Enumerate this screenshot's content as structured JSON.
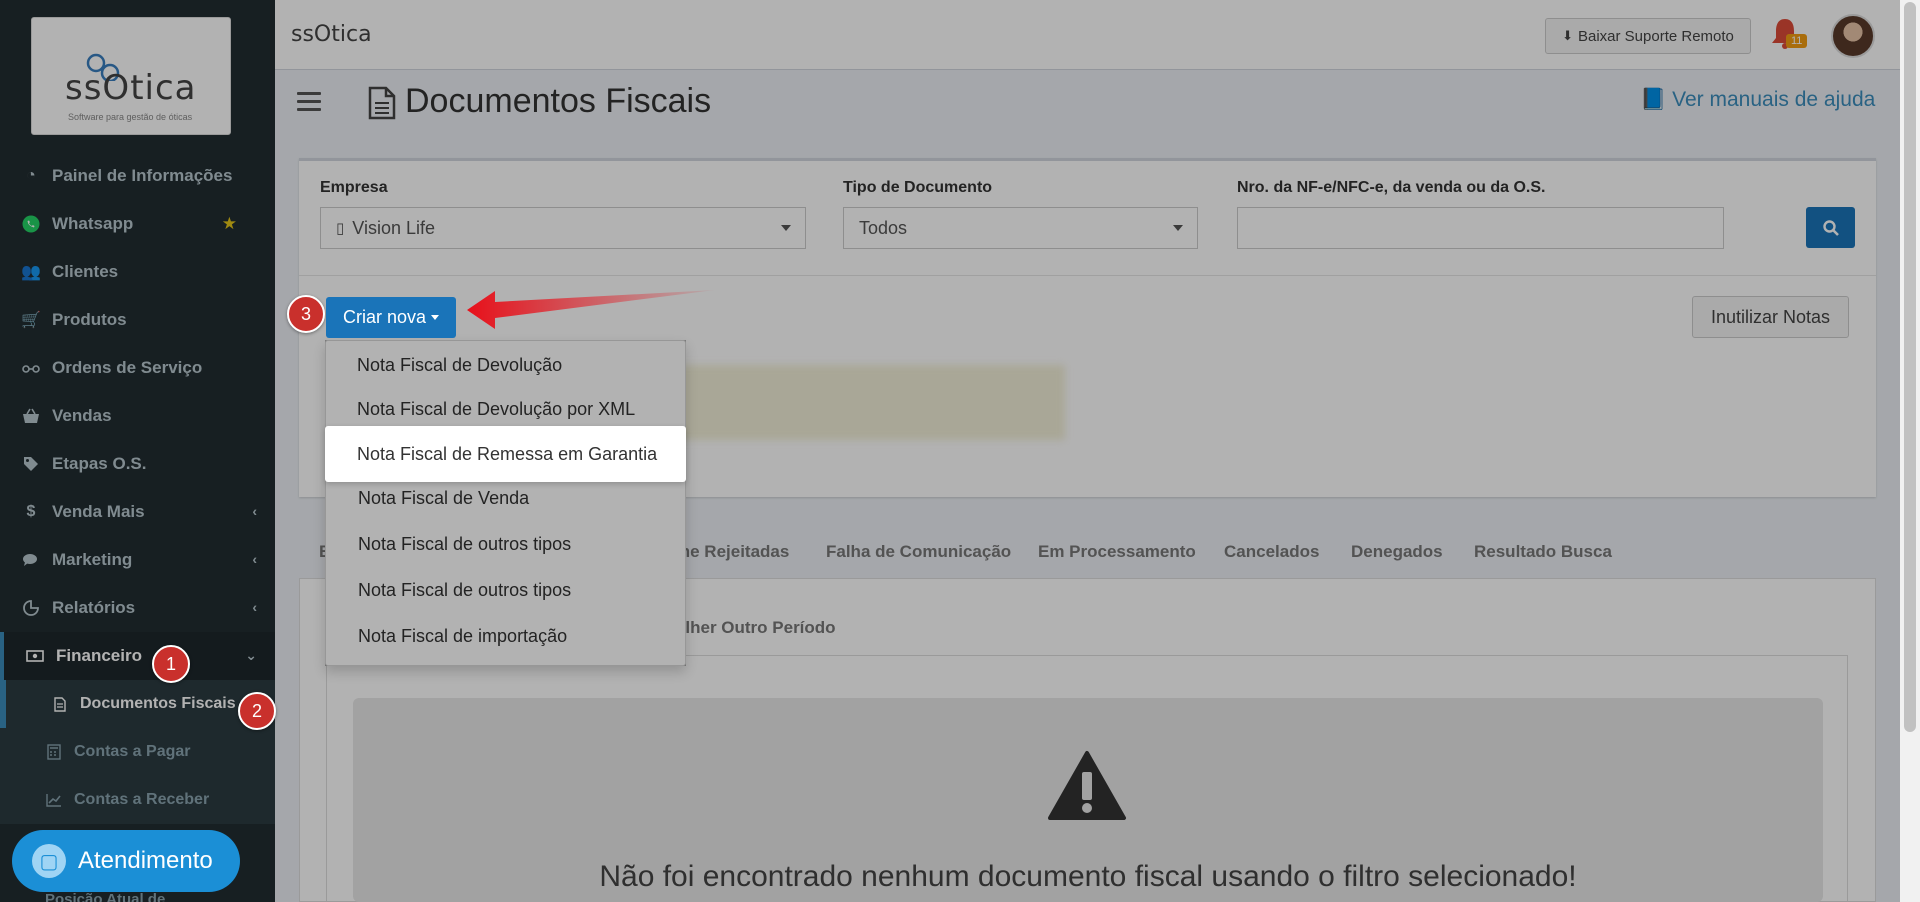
{
  "sidebar": {
    "logo": {
      "brand": "ssOtica",
      "tagline": "Software para gestão de óticas"
    },
    "items": [
      {
        "label": "Painel de Informações",
        "icon": "dashboard-icon"
      },
      {
        "label": "Whatsapp",
        "icon": "whatsapp-icon"
      },
      {
        "label": "Clientes",
        "icon": "users-icon"
      },
      {
        "label": "Produtos",
        "icon": "cart-icon"
      },
      {
        "label": "Ordens de Serviço",
        "icon": "glasses-icon"
      },
      {
        "label": "Vendas",
        "icon": "basket-icon"
      },
      {
        "label": "Etapas O.S.",
        "icon": "tag-icon"
      },
      {
        "label": "Venda Mais",
        "icon": "dollar-icon"
      },
      {
        "label": "Marketing",
        "icon": "comments-icon"
      },
      {
        "label": "Relatórios",
        "icon": "pie-chart-icon"
      },
      {
        "label": "Financeiro",
        "icon": "money-icon"
      }
    ],
    "subitems": [
      {
        "label": "Documentos Fiscais",
        "icon": "file-icon"
      },
      {
        "label": "Contas a Pagar",
        "icon": "calculator-icon"
      },
      {
        "label": "Contas a Receber",
        "icon": "line-chart-icon"
      }
    ],
    "cut_item": "Posição Atual de",
    "atendimento": "Atendimento"
  },
  "annotations": {
    "one": "1",
    "two": "2",
    "three": "3"
  },
  "topbar": {
    "brand": "ssOtica",
    "suporte": "Baixar Suporte Remoto",
    "notif_count": "11"
  },
  "header": {
    "title": "Documentos Fiscais",
    "help": "Ver manuais de ajuda"
  },
  "filters": {
    "empresa_label": "Empresa",
    "empresa_value": "Vision Life",
    "tipo_label": "Tipo de Documento",
    "tipo_value": "Todos",
    "nro_label": "Nro. da NF-e/NFC-e, da venda ou da O.S.",
    "nro_value": ""
  },
  "actions": {
    "criar": "Criar nova",
    "inutilizar": "Inutilizar Notas"
  },
  "dropdown": {
    "items": [
      "Nota Fiscal de Devolução",
      "Nota Fiscal de Devolução por XML",
      "Nota Fiscal de Remessa em Garantia",
      "Nota Fiscal de Venda",
      "Nota Fiscal de outros tipos",
      "Nota Fiscal de outros tipos",
      "Nota Fiscal de importação"
    ]
  },
  "tabs": {
    "first_partial": "E",
    "rejeitadas_partial": "me Rejeitadas",
    "items": [
      "Falha de Comunicação",
      "Em Processamento",
      "Cancelados",
      "Denegados",
      "Resultado Busca"
    ],
    "period_partial": "olher Outro Período"
  },
  "empty": {
    "message": "Não foi encontrado nenhum documento fiscal usando o filtro selecionado!"
  },
  "colors": {
    "primary": "#1a74b9",
    "sidebar": "#222d32",
    "badge": "#c9302c",
    "link": "#3c8dbc"
  }
}
